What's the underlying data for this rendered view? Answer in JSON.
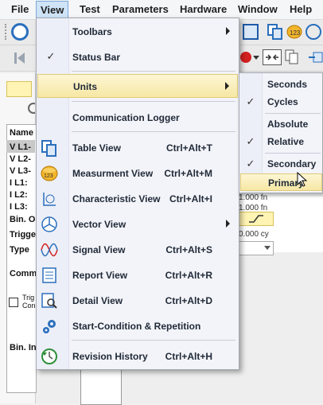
{
  "menubar": [
    "File",
    "View",
    "Test",
    "Parameters",
    "Hardware",
    "Window",
    "Help"
  ],
  "left_rows": [
    "Name",
    "V L1-",
    "V L2-",
    "V L3-",
    "I L1:",
    "I L2:",
    "I L3:",
    "Bin. O",
    "Trigge",
    "Type",
    "Comm",
    "Trig",
    "Con",
    "Bin. In"
  ],
  "right_values": [
    "1.000 fn",
    "1.000 fn",
    "0.000 cy"
  ],
  "view_menu": {
    "toolbars": "Toolbars",
    "status_bar": "Status Bar",
    "units": "Units",
    "communication_logger": "Communication Logger",
    "table_view": {
      "label": "Table View",
      "shortcut": "Ctrl+Alt+T"
    },
    "measurement_view": {
      "label": "Measurment View",
      "shortcut": "Ctrl+Alt+M"
    },
    "characteristic_view": {
      "label": "Characteristic View",
      "shortcut": "Ctrl+Alt+I"
    },
    "vector_view": "Vector View",
    "signal_view": {
      "label": "Signal View",
      "shortcut": "Ctrl+Alt+S"
    },
    "report_view": {
      "label": "Report View",
      "shortcut": "Ctrl+Alt+R"
    },
    "detail_view": {
      "label": "Detail View",
      "shortcut": "Ctrl+Alt+D"
    },
    "start_condition": "Start-Condition & Repetition",
    "revision_history": {
      "label": "Revision History",
      "shortcut": "Ctrl+Alt+H"
    }
  },
  "units_submenu": {
    "seconds": "Seconds",
    "cycles": "Cycles",
    "absolute": "Absolute",
    "relative": "Relative",
    "secondary": "Secondary",
    "primary": "Primary"
  },
  "colors": {
    "highlight": "#f6e7a4",
    "menu_bg": "#f3f4f9",
    "accent_blue": "#2a6fbd"
  }
}
